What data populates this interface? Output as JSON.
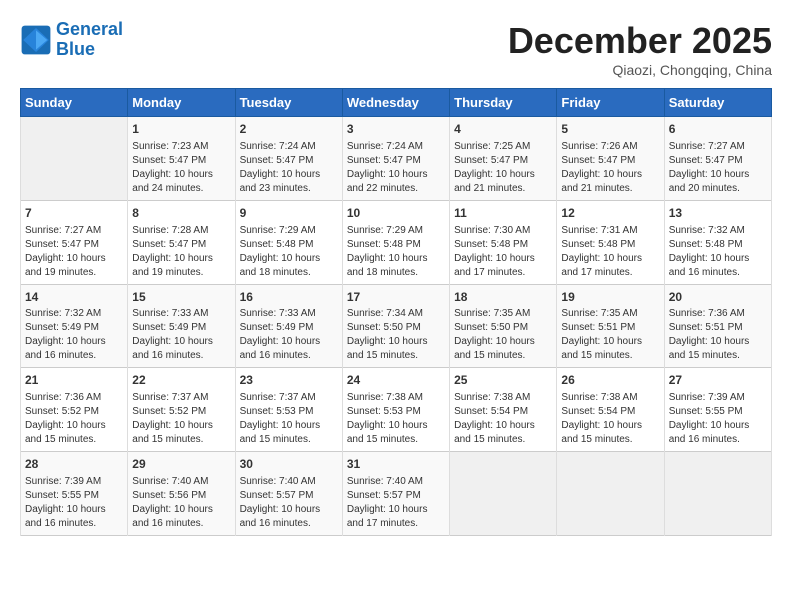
{
  "header": {
    "logo_line1": "General",
    "logo_line2": "Blue",
    "title": "December 2025",
    "subtitle": "Qiaozi, Chongqing, China"
  },
  "weekdays": [
    "Sunday",
    "Monday",
    "Tuesday",
    "Wednesday",
    "Thursday",
    "Friday",
    "Saturday"
  ],
  "weeks": [
    [
      {
        "day": "",
        "info": ""
      },
      {
        "day": "1",
        "info": "Sunrise: 7:23 AM\nSunset: 5:47 PM\nDaylight: 10 hours\nand 24 minutes."
      },
      {
        "day": "2",
        "info": "Sunrise: 7:24 AM\nSunset: 5:47 PM\nDaylight: 10 hours\nand 23 minutes."
      },
      {
        "day": "3",
        "info": "Sunrise: 7:24 AM\nSunset: 5:47 PM\nDaylight: 10 hours\nand 22 minutes."
      },
      {
        "day": "4",
        "info": "Sunrise: 7:25 AM\nSunset: 5:47 PM\nDaylight: 10 hours\nand 21 minutes."
      },
      {
        "day": "5",
        "info": "Sunrise: 7:26 AM\nSunset: 5:47 PM\nDaylight: 10 hours\nand 21 minutes."
      },
      {
        "day": "6",
        "info": "Sunrise: 7:27 AM\nSunset: 5:47 PM\nDaylight: 10 hours\nand 20 minutes."
      }
    ],
    [
      {
        "day": "7",
        "info": "Sunrise: 7:27 AM\nSunset: 5:47 PM\nDaylight: 10 hours\nand 19 minutes."
      },
      {
        "day": "8",
        "info": "Sunrise: 7:28 AM\nSunset: 5:47 PM\nDaylight: 10 hours\nand 19 minutes."
      },
      {
        "day": "9",
        "info": "Sunrise: 7:29 AM\nSunset: 5:48 PM\nDaylight: 10 hours\nand 18 minutes."
      },
      {
        "day": "10",
        "info": "Sunrise: 7:29 AM\nSunset: 5:48 PM\nDaylight: 10 hours\nand 18 minutes."
      },
      {
        "day": "11",
        "info": "Sunrise: 7:30 AM\nSunset: 5:48 PM\nDaylight: 10 hours\nand 17 minutes."
      },
      {
        "day": "12",
        "info": "Sunrise: 7:31 AM\nSunset: 5:48 PM\nDaylight: 10 hours\nand 17 minutes."
      },
      {
        "day": "13",
        "info": "Sunrise: 7:32 AM\nSunset: 5:48 PM\nDaylight: 10 hours\nand 16 minutes."
      }
    ],
    [
      {
        "day": "14",
        "info": "Sunrise: 7:32 AM\nSunset: 5:49 PM\nDaylight: 10 hours\nand 16 minutes."
      },
      {
        "day": "15",
        "info": "Sunrise: 7:33 AM\nSunset: 5:49 PM\nDaylight: 10 hours\nand 16 minutes."
      },
      {
        "day": "16",
        "info": "Sunrise: 7:33 AM\nSunset: 5:49 PM\nDaylight: 10 hours\nand 16 minutes."
      },
      {
        "day": "17",
        "info": "Sunrise: 7:34 AM\nSunset: 5:50 PM\nDaylight: 10 hours\nand 15 minutes."
      },
      {
        "day": "18",
        "info": "Sunrise: 7:35 AM\nSunset: 5:50 PM\nDaylight: 10 hours\nand 15 minutes."
      },
      {
        "day": "19",
        "info": "Sunrise: 7:35 AM\nSunset: 5:51 PM\nDaylight: 10 hours\nand 15 minutes."
      },
      {
        "day": "20",
        "info": "Sunrise: 7:36 AM\nSunset: 5:51 PM\nDaylight: 10 hours\nand 15 minutes."
      }
    ],
    [
      {
        "day": "21",
        "info": "Sunrise: 7:36 AM\nSunset: 5:52 PM\nDaylight: 10 hours\nand 15 minutes."
      },
      {
        "day": "22",
        "info": "Sunrise: 7:37 AM\nSunset: 5:52 PM\nDaylight: 10 hours\nand 15 minutes."
      },
      {
        "day": "23",
        "info": "Sunrise: 7:37 AM\nSunset: 5:53 PM\nDaylight: 10 hours\nand 15 minutes."
      },
      {
        "day": "24",
        "info": "Sunrise: 7:38 AM\nSunset: 5:53 PM\nDaylight: 10 hours\nand 15 minutes."
      },
      {
        "day": "25",
        "info": "Sunrise: 7:38 AM\nSunset: 5:54 PM\nDaylight: 10 hours\nand 15 minutes."
      },
      {
        "day": "26",
        "info": "Sunrise: 7:38 AM\nSunset: 5:54 PM\nDaylight: 10 hours\nand 15 minutes."
      },
      {
        "day": "27",
        "info": "Sunrise: 7:39 AM\nSunset: 5:55 PM\nDaylight: 10 hours\nand 16 minutes."
      }
    ],
    [
      {
        "day": "28",
        "info": "Sunrise: 7:39 AM\nSunset: 5:55 PM\nDaylight: 10 hours\nand 16 minutes."
      },
      {
        "day": "29",
        "info": "Sunrise: 7:40 AM\nSunset: 5:56 PM\nDaylight: 10 hours\nand 16 minutes."
      },
      {
        "day": "30",
        "info": "Sunrise: 7:40 AM\nSunset: 5:57 PM\nDaylight: 10 hours\nand 16 minutes."
      },
      {
        "day": "31",
        "info": "Sunrise: 7:40 AM\nSunset: 5:57 PM\nDaylight: 10 hours\nand 17 minutes."
      },
      {
        "day": "",
        "info": ""
      },
      {
        "day": "",
        "info": ""
      },
      {
        "day": "",
        "info": ""
      }
    ]
  ]
}
